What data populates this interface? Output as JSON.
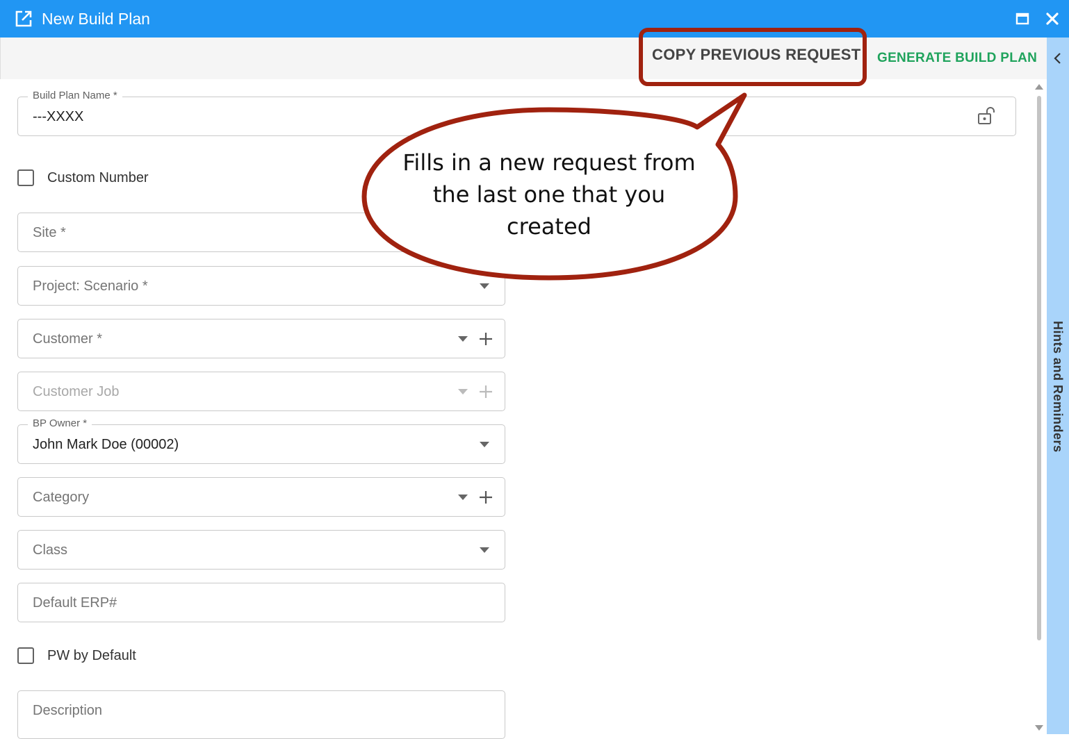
{
  "window": {
    "title": "New Build Plan",
    "icons": {
      "app": "open-in-new-icon",
      "maximize": "maximize-icon",
      "close": "close-icon"
    }
  },
  "toolbar": {
    "copy_previous_label": "COPY PREVIOUS REQUEST",
    "generate_label": "GENERATE BUILD PLAN"
  },
  "form": {
    "build_plan_name": {
      "label": "Build Plan Name *",
      "value": "---XXXX"
    },
    "custom_number": {
      "label": "Custom Number",
      "checked": false
    },
    "site": {
      "label": "Site *"
    },
    "project_scenario": {
      "label": "Project: Scenario *"
    },
    "customer": {
      "label": "Customer *"
    },
    "customer_job": {
      "label": "Customer Job",
      "disabled": true
    },
    "bp_owner": {
      "label": "BP Owner *",
      "value": "John Mark Doe (00002)"
    },
    "category": {
      "label": "Category"
    },
    "class": {
      "label": "Class"
    },
    "default_erp": {
      "label": "Default ERP#"
    },
    "pw_by_default": {
      "label": "PW by Default",
      "checked": false
    },
    "description": {
      "label": "Description"
    }
  },
  "hints_panel": {
    "label": "Hints and Reminders"
  },
  "callout": {
    "text": "Fills in a new request from the last one that you created",
    "color": "#a0220f"
  },
  "colors": {
    "titlebar": "#2196f3",
    "generate": "#1fa35c",
    "hints_panel": "#a9d4fa"
  }
}
